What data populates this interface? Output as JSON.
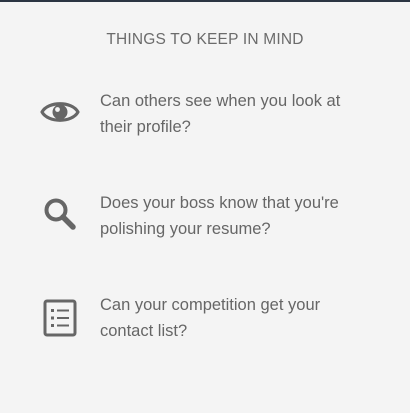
{
  "heading": "THINGS TO KEEP IN MIND",
  "tips": [
    {
      "icon": "eye-icon",
      "text": "Can others see when you look at their profile?"
    },
    {
      "icon": "magnifier-icon",
      "text": "Does your boss know that you're polishing your resume?"
    },
    {
      "icon": "list-icon",
      "text": "Can your competition get your contact list?"
    }
  ],
  "colors": {
    "background": "#f4f4f4",
    "text": "#666666",
    "icon": "#666666",
    "top_border": "#2b3542"
  }
}
